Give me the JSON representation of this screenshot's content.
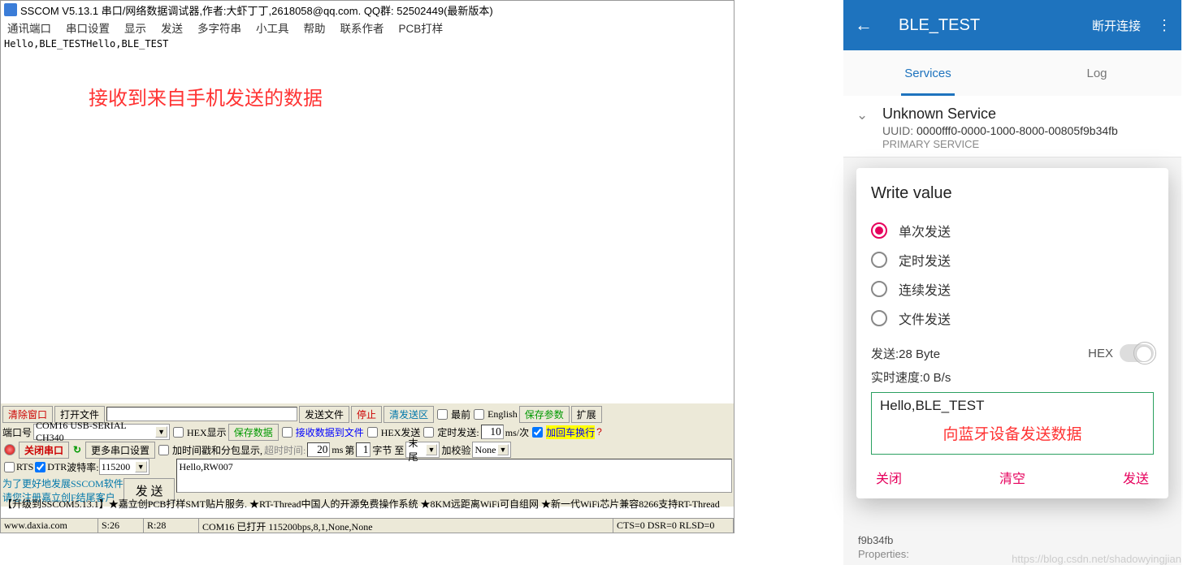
{
  "sscom": {
    "title": "SSCOM V5.13.1 串口/网络数据调试器,作者:大虾丁丁,2618058@qq.com. QQ群: 52502449(最新版本)",
    "menu": [
      "通讯端口",
      "串口设置",
      "显示",
      "发送",
      "多字符串",
      "小工具",
      "帮助",
      "联系作者",
      "PCB打样"
    ],
    "rx_text": "Hello,BLE_TESTHello,BLE_TEST",
    "rx_annotation": "接收到来自手机发送的数据",
    "ctrl": {
      "clear_window": "清除窗口",
      "open_file": "打开文件",
      "send_file": "发送文件",
      "stop": "停止",
      "clear_send": "清发送区",
      "top": "最前",
      "english": "English",
      "save_params": "保存参数",
      "expand": "扩展",
      "port_label": "端口号",
      "port_value": "COM16 USB-SERIAL CH340",
      "hex_show": "HEX显示",
      "save_data": "保存数据",
      "rx_to_file": "接收数据到文件",
      "hex_send": "HEX发送",
      "timed_send": "定时发送:",
      "timed_val": "10",
      "timed_unit": "ms/次",
      "cr_lf": "加回车换行",
      "close_port": "关闭串口",
      "more_settings": "更多串口设置",
      "timestamp": "加时间戳和分包显示,",
      "timeout_label": "超时时间:",
      "timeout_val": "20",
      "ms": "ms",
      "nth_label": "第",
      "nth_val": "1",
      "byte_to": "字节 至",
      "tail": "末尾",
      "check_label": "加校验",
      "check_val": "None",
      "rts": "RTS",
      "dtr": "DTR",
      "baud_label": "波特率:",
      "baud_val": "115200",
      "tx_value": "Hello,RW007",
      "promo1": "为了更好地发展SSCOM软件",
      "promo2": "请您注册嘉立创F结尾客户",
      "send_btn": "发  送",
      "upgrade": "【升级到SSCOM5.13.1】★嘉立创PCB打样SMT贴片服务. ★RT-Thread中国人的开源免费操作系统 ★8KM远距离WiFi可自组网 ★新一代WiFi芯片兼容8266支持RT-Thread"
    },
    "status": {
      "url": "www.daxia.com",
      "s": "S:26",
      "r": "R:28",
      "com": "COM16 已打开 115200bps,8,1,None,None",
      "cts": "CTS=0 DSR=0 RLSD=0"
    }
  },
  "phone": {
    "title": "BLE_TEST",
    "disconnect": "断开连接",
    "tabs": {
      "services": "Services",
      "log": "Log"
    },
    "service": {
      "name": "Unknown Service",
      "uuid_label": "UUID:",
      "uuid": "0000fff0-0000-1000-8000-00805f9b34fb",
      "type": "PRIMARY SERVICE"
    },
    "dialog": {
      "title": "Write value",
      "radios": [
        "单次发送",
        "定时发送",
        "连续发送",
        "文件发送"
      ],
      "send_info": "发送:28 Byte",
      "hex": "HEX",
      "speed": "实时速度:0 B/s",
      "input_value": "Hello,BLE_TEST",
      "annotation": "向蓝牙设备发送数据",
      "btn_close": "关闭",
      "btn_clear": "清空",
      "btn_send": "发送"
    },
    "char": {
      "uuid": "f9b34fb",
      "props": "Properties:"
    }
  },
  "watermark": "https://blog.csdn.net/shadowyingjian"
}
